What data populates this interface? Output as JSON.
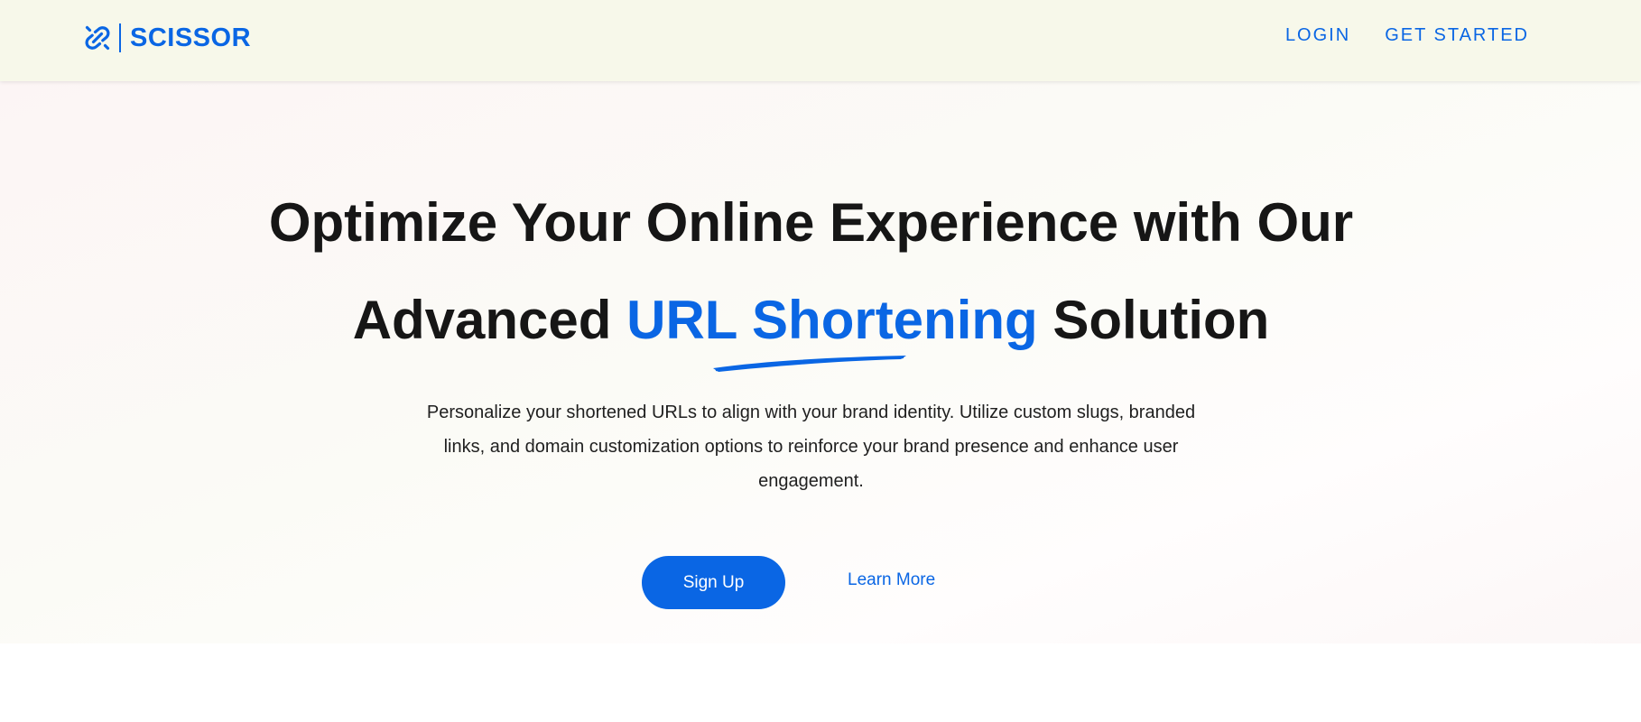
{
  "brand": {
    "name": "SCISSOR",
    "icon": "link-icon",
    "color": "#0a66e4"
  },
  "nav": {
    "login": "LOGIN",
    "get_started": "GET STARTED"
  },
  "hero": {
    "headline_line1": "Optimize Your Online Experience with Our",
    "headline_line2_before": "Advanced",
    "headline_line2_accent": "URL Shortening",
    "headline_line2_after": "Solution",
    "description": "Personalize your shortened URLs to align with your brand identity. Utilize custom slugs, branded links, and domain customization options to reinforce your brand presence and enhance user engagement.",
    "primary_cta": "Sign Up",
    "secondary_cta": "Learn More"
  },
  "colors": {
    "accent": "#0a66e4",
    "navbar_bg": "#f7f8ea",
    "text": "#161616"
  }
}
